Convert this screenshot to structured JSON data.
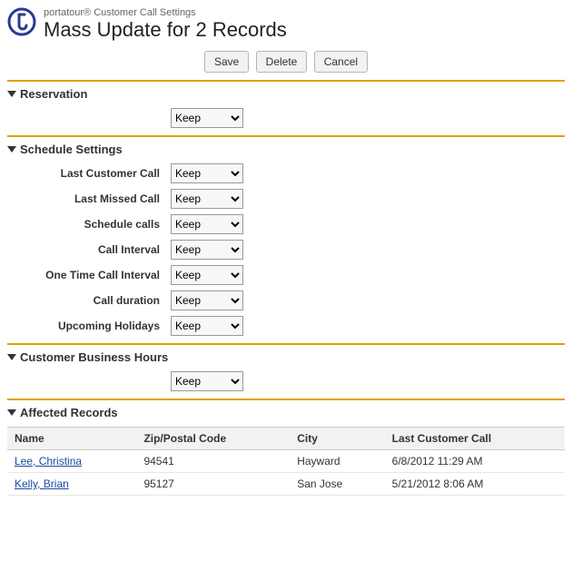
{
  "header": {
    "breadcrumb": "portatour® Customer Call Settings",
    "title": "Mass Update for 2 Records"
  },
  "buttons": {
    "save": "Save",
    "delete": "Delete",
    "cancel": "Cancel"
  },
  "select_default": "Keep",
  "sections": {
    "reservation": {
      "title": "Reservation"
    },
    "schedule": {
      "title": "Schedule Settings",
      "fields": {
        "last_customer_call": "Last Customer Call",
        "last_missed_call": "Last Missed Call",
        "schedule_calls": "Schedule calls",
        "call_interval": "Call Interval",
        "one_time_call_interval": "One Time Call Interval",
        "call_duration": "Call duration",
        "upcoming_holidays": "Upcoming Holidays"
      }
    },
    "business_hours": {
      "title": "Customer Business Hours"
    },
    "affected": {
      "title": "Affected Records",
      "columns": {
        "name": "Name",
        "zip": "Zip/Postal Code",
        "city": "City",
        "last_call": "Last Customer Call"
      },
      "rows": [
        {
          "name": "Lee, Christina",
          "zip": "94541",
          "city": "Hayward",
          "last_call": "6/8/2012 11:29 AM"
        },
        {
          "name": "Kelly, Brian",
          "zip": "95127",
          "city": "San Jose",
          "last_call": "5/21/2012 8:06 AM"
        }
      ]
    }
  }
}
